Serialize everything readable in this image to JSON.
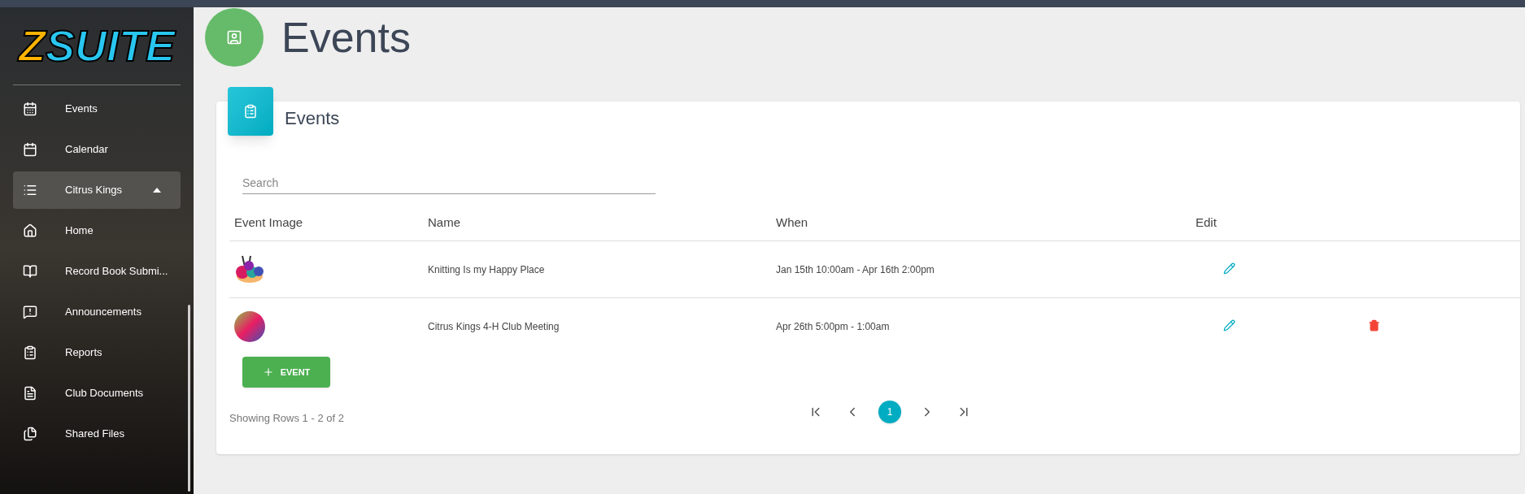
{
  "sidebar": {
    "logo": [
      "Z",
      "SUITE"
    ],
    "items": [
      {
        "label": "Events",
        "selected": false
      },
      {
        "label": "Calendar",
        "selected": false
      },
      {
        "label": "Citrus Kings",
        "selected": true,
        "expanded": true,
        "children": [
          {
            "label": "Home",
            "selected": false
          },
          {
            "label": "Record Book Submi...",
            "selected": false
          },
          {
            "label": "Announcements",
            "selected": false
          },
          {
            "label": "Reports",
            "selected": false
          },
          {
            "label": "Club Documents",
            "selected": false
          },
          {
            "label": "Shared Files",
            "selected": false
          }
        ]
      }
    ]
  },
  "page": {
    "title": "Events"
  },
  "card": {
    "title": "Events",
    "search": {
      "placeholder": "Search"
    },
    "table": {
      "columns": [
        "Event Image",
        "Name",
        "When",
        "Edit"
      ],
      "rows": [
        {
          "kind": "yarn",
          "name": "Knitting Is my Happy Place",
          "when": "Jan 15th 10:00am - Apr 16th 2:00pm",
          "deletable": false
        },
        {
          "kind": "abstract",
          "name": "Citrus Kings 4-H Club Meeting",
          "when": "Apr 26th 5:00pm - 1:00am",
          "deletable": true
        }
      ]
    },
    "add_button": "EVENT",
    "footer": "Showing Rows 1 - 2 of 2",
    "pages": [
      {
        "label": "1",
        "selected": true
      }
    ]
  }
}
